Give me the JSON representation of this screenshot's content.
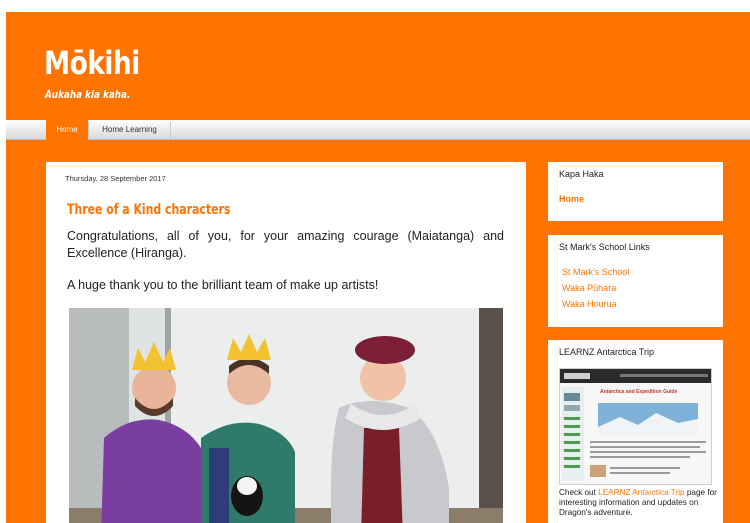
{
  "header": {
    "title": "Mōkihi",
    "description": "Aukaha kia kaha."
  },
  "tabs": [
    {
      "label": "Home"
    },
    {
      "label": "Home Learning"
    }
  ],
  "post": {
    "date": "Thursday, 28 September 2017",
    "title": "Three of a Kind characters",
    "paragraph1": "Congratulations, all of you, for your amazing courage (Maiatanga) and Excellence (Hiranga).",
    "paragraph2": "A huge thank you to the brilliant team of make up artists!"
  },
  "sidebar": {
    "kapa_haka": {
      "title": "Kapa Haka",
      "link": "Home"
    },
    "links": {
      "title": "St Mark's School Links",
      "items": [
        "St Mark's School",
        "Waka Pūhara",
        "Waka Hourua"
      ]
    },
    "learnz": {
      "title": "LEARNZ Antarctica Trip",
      "caption_prefix": "Check out ",
      "caption_link": "LEARNZ Antarctica Trip",
      "caption_suffix": " page for interesting information and updates on Dragon's adventure.",
      "thumb_heading": "Antarctica and Expedition Guide"
    }
  },
  "colors": {
    "brand": "#ff7400",
    "card": "#ffffff",
    "text": "#222222"
  }
}
